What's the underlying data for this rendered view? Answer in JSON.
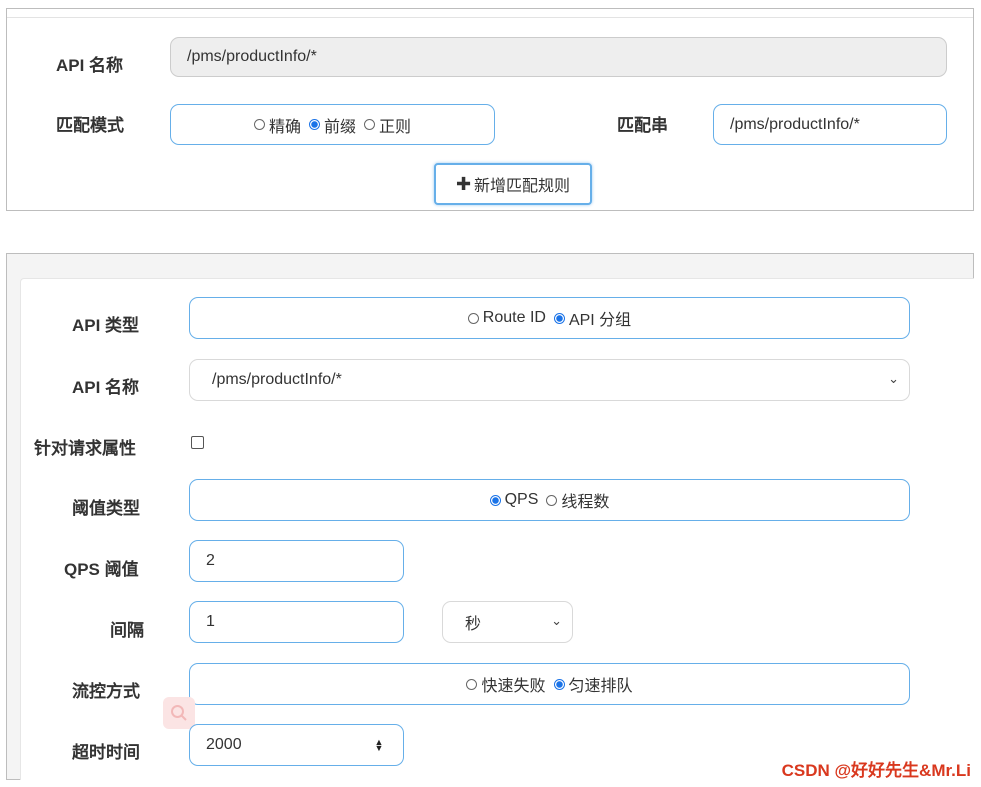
{
  "panel1": {
    "api_name_label": "API 名称",
    "api_name_value": "/pms/productInfo/*",
    "match_mode_label": "匹配模式",
    "match_mode_options": [
      "精确",
      "前缀",
      "正则"
    ],
    "match_mode_selected": "前缀",
    "match_string_label": "匹配串",
    "match_string_value": "/pms/productInfo/*",
    "add_rule_label": "新增匹配规则"
  },
  "panel2": {
    "api_type_label": "API 类型",
    "api_type_options": [
      "Route ID",
      "API 分组"
    ],
    "api_type_selected": "API 分组",
    "api_name_label": "API 名称",
    "api_name_selected": "/pms/productInfo/*",
    "request_attr_label": "针对请求属性",
    "threshold_type_label": "阈值类型",
    "threshold_type_options": [
      "QPS",
      "线程数"
    ],
    "threshold_type_selected": "QPS",
    "qps_label": "QPS 阈值",
    "qps_value": "2",
    "interval_label": "间隔",
    "interval_value": "1",
    "interval_unit": "秒",
    "control_mode_label": "流控方式",
    "control_mode_options": [
      "快速失败",
      "匀速排队"
    ],
    "control_mode_selected": "匀速排队",
    "timeout_label": "超时时间",
    "timeout_value": "2000"
  },
  "watermark": "CSDN @好好先生&Mr.Li",
  "colors": {
    "focus_border": "#66afe9",
    "radio_selected": "#1a73e8",
    "watermark": "#d9381e"
  }
}
